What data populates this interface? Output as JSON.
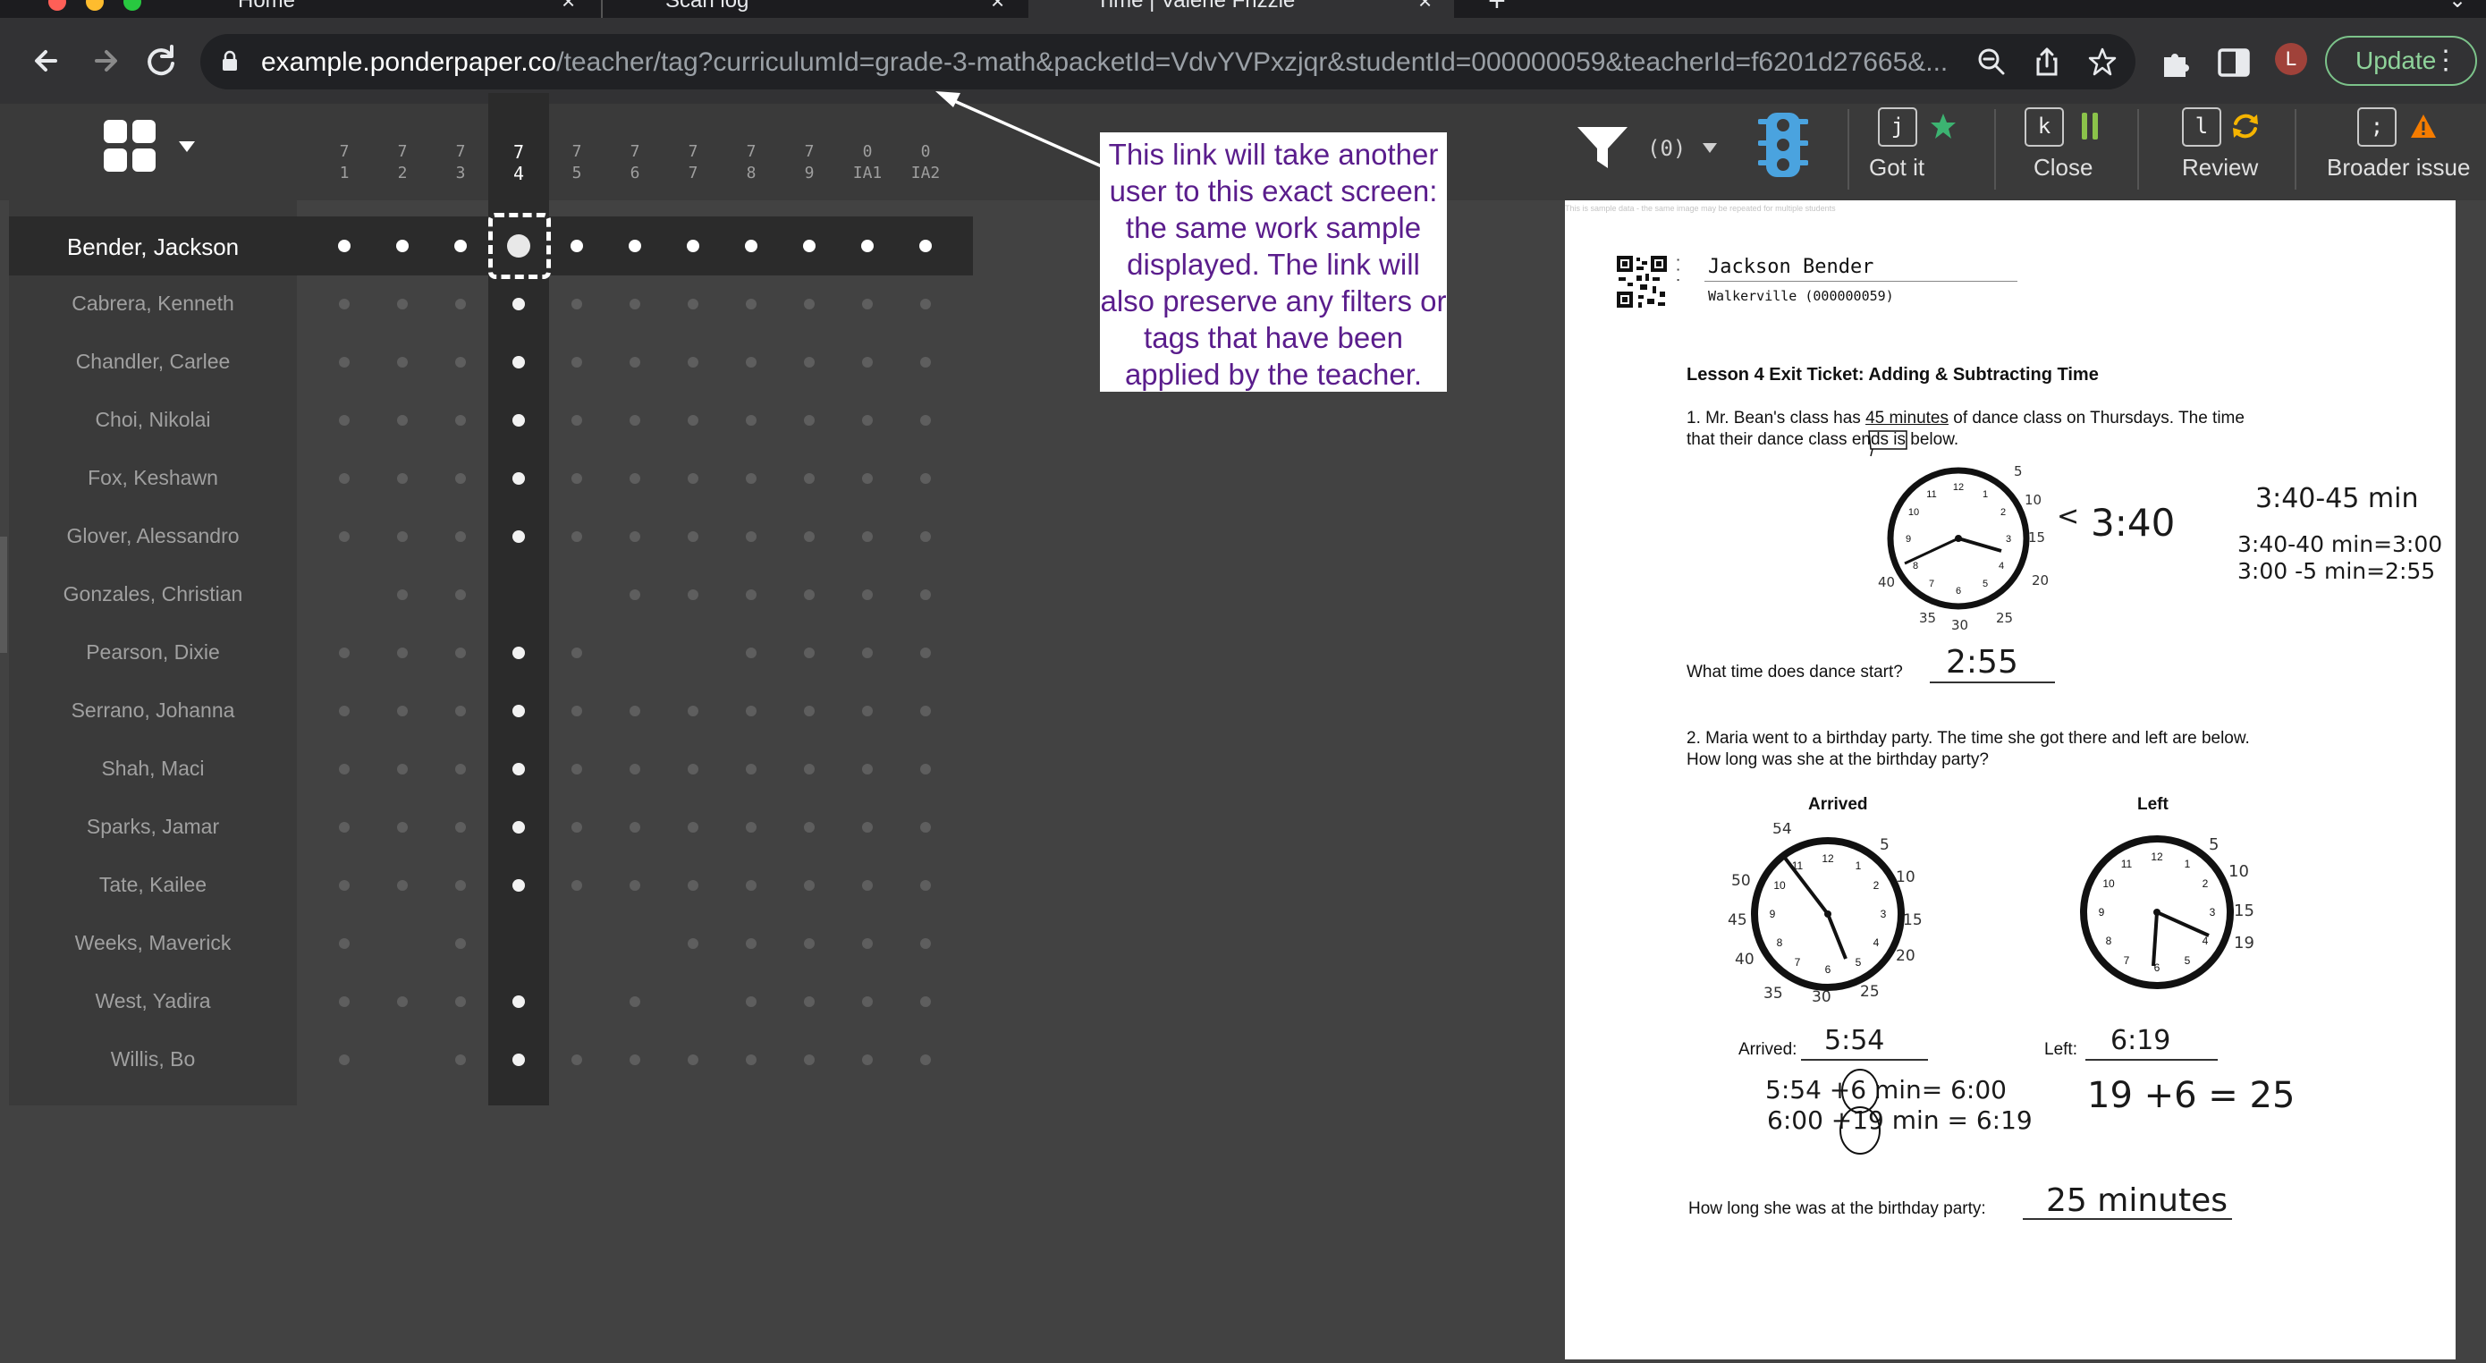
{
  "browser": {
    "tabs": [
      {
        "title": "Home"
      },
      {
        "title": "Scan log"
      },
      {
        "title": "Time | Valerie Frizzle"
      }
    ],
    "new_tab": "+",
    "url_host": "example.ponderpaper.co",
    "url_path": "/teacher/tag?curriculumId=grade-3-math&packetId=VdvYVPxzjqr&studentId=000000059&teacherId=f6201d27665&...",
    "avatar_initial": "L",
    "update_label": "Update"
  },
  "columns": [
    {
      "top": "7",
      "bottom": "1"
    },
    {
      "top": "7",
      "bottom": "2"
    },
    {
      "top": "7",
      "bottom": "3"
    },
    {
      "top": "7",
      "bottom": "4"
    },
    {
      "top": "7",
      "bottom": "5"
    },
    {
      "top": "7",
      "bottom": "6"
    },
    {
      "top": "7",
      "bottom": "7"
    },
    {
      "top": "7",
      "bottom": "8"
    },
    {
      "top": "7",
      "bottom": "9"
    },
    {
      "top": "0",
      "bottom": "IA1"
    },
    {
      "top": "0",
      "bottom": "IA2"
    }
  ],
  "active_column_index": 3,
  "students": [
    {
      "name": "Bender, Jackson",
      "dots": [
        1,
        1,
        1,
        1,
        1,
        1,
        1,
        1,
        1,
        1,
        1
      ]
    },
    {
      "name": "Cabrera, Kenneth",
      "dots": [
        1,
        1,
        1,
        1,
        1,
        1,
        1,
        1,
        1,
        1,
        1
      ]
    },
    {
      "name": "Chandler, Carlee",
      "dots": [
        1,
        1,
        1,
        1,
        1,
        1,
        1,
        1,
        1,
        1,
        1
      ]
    },
    {
      "name": "Choi, Nikolai",
      "dots": [
        1,
        1,
        1,
        1,
        1,
        1,
        1,
        1,
        1,
        1,
        1
      ]
    },
    {
      "name": "Fox, Keshawn",
      "dots": [
        1,
        1,
        1,
        1,
        1,
        1,
        1,
        1,
        1,
        1,
        1
      ]
    },
    {
      "name": "Glover, Alessandro",
      "dots": [
        1,
        1,
        1,
        1,
        1,
        1,
        1,
        1,
        1,
        1,
        1
      ]
    },
    {
      "name": "Gonzales, Christian",
      "dots": [
        0,
        1,
        1,
        0,
        0,
        1,
        1,
        1,
        1,
        1,
        1
      ]
    },
    {
      "name": "Pearson, Dixie",
      "dots": [
        1,
        1,
        1,
        1,
        1,
        0,
        0,
        1,
        1,
        1,
        1
      ]
    },
    {
      "name": "Serrano, Johanna",
      "dots": [
        1,
        1,
        1,
        1,
        1,
        1,
        1,
        1,
        1,
        1,
        1
      ]
    },
    {
      "name": "Shah, Maci",
      "dots": [
        1,
        1,
        1,
        1,
        1,
        1,
        1,
        1,
        1,
        1,
        1
      ]
    },
    {
      "name": "Sparks, Jamar",
      "dots": [
        1,
        1,
        1,
        1,
        1,
        1,
        1,
        1,
        1,
        1,
        1
      ]
    },
    {
      "name": "Tate, Kailee",
      "dots": [
        1,
        1,
        1,
        1,
        1,
        1,
        1,
        1,
        1,
        1,
        1
      ]
    },
    {
      "name": "Weeks, Maverick",
      "dots": [
        1,
        0,
        1,
        0,
        0,
        0,
        1,
        1,
        1,
        1,
        1
      ]
    },
    {
      "name": "West, Yadira",
      "dots": [
        1,
        1,
        1,
        1,
        0,
        1,
        0,
        1,
        1,
        1,
        1
      ]
    },
    {
      "name": "Willis, Bo",
      "dots": [
        1,
        0,
        1,
        1,
        1,
        1,
        1,
        1,
        1,
        1,
        1
      ]
    }
  ],
  "selected_student_index": 0,
  "callout_text": "This link will take another user to this exact screen: the same work sample displayed. The link will also preserve any filters or tags that have been applied by the teacher.",
  "filter": {
    "count": "(0)"
  },
  "tools": [
    {
      "key": "j",
      "label": "Got it",
      "icon": "star-icon",
      "color": "#3cb371"
    },
    {
      "key": "k",
      "label": "Close",
      "icon": "pause-bars-icon",
      "color": "#8bc34a"
    },
    {
      "key": "l",
      "label": "Review",
      "icon": "refresh-icon",
      "color": "#f5b400"
    },
    {
      "key": ";",
      "label": "Broader issue",
      "icon": "warning-icon",
      "color": "#f57c00"
    }
  ],
  "worksheet": {
    "sample_note": "This is sample data - the same image may be repeated for multiple students",
    "student_name": "Jackson Bender",
    "school": "Walkerville (000000059)",
    "title": "Lesson 4 Exit Ticket: Adding & Subtracting Time",
    "q1_line1_pre": "1. Mr. Bean's class has ",
    "q1_line1_ul": "45 minutes",
    "q1_line1_post": " of dance class on Thursdays.  The time",
    "q1_line2": "that their dance class ends is below.",
    "q1_prompt": "What time does dance start?",
    "q1_answer": "2:55",
    "q1_work_time": "3:40",
    "q1_work_1": "3:40-45 min",
    "q1_work_2": "3:40-40 min=3:00",
    "q1_work_3": "3:00 -5 min=2:55",
    "q2_line1": "2.  Maria went to a birthday party. The time she got there and left are below.",
    "q2_line2": "How long was she at the birthday party?",
    "arrived_heading": "Arrived",
    "left_heading": "Left",
    "arrived_label": "Arrived:",
    "arrived_answer": "5:54",
    "left_label": "Left:",
    "left_answer": "6:19",
    "q2_work_1": "5:54 +6 min= 6:00",
    "q2_work_2": "6:00 +19 min = 6:19",
    "q2_work_3": "19 +6 = 25",
    "q2_prompt": "How long she was at the birthday party:",
    "q2_answer": "25 minutes",
    "clock_labels": {
      "c1_left": "40",
      "c1_right": "15",
      "c1_right2": "20",
      "c1_bottom": "35",
      "c1_bottom2": "30",
      "c1_bottom3": "25",
      "c1_top": "5",
      "c1_top2": "10",
      "c2_top": "54",
      "c2_left1": "50",
      "c2_left2": "45",
      "c2_left3": "40",
      "c2_bottom1": "35",
      "c2_bottom2": "30",
      "c2_bottom3": "25",
      "c2_right1": "20",
      "c2_right2": "15",
      "c2_right3": "10",
      "c2_top2": "5",
      "c3_r1": "5",
      "c3_r2": "10",
      "c3_r3": "15",
      "c3_r4": "19"
    }
  }
}
